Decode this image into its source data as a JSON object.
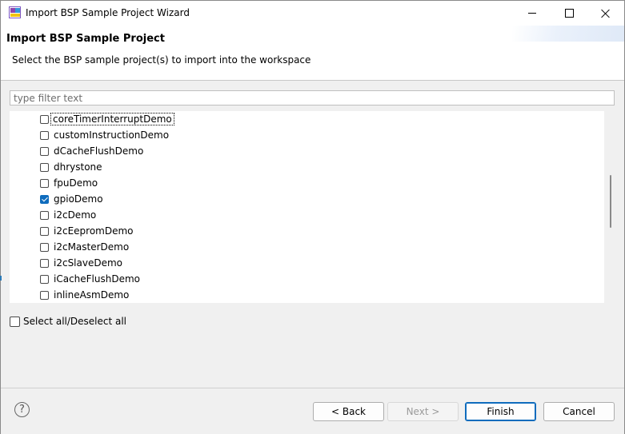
{
  "window": {
    "title": "Import BSP Sample Project Wizard"
  },
  "header": {
    "title": "Import BSP Sample Project",
    "description": "Select the BSP sample project(s) to import into the workspace"
  },
  "filter": {
    "placeholder": "type filter text",
    "value": ""
  },
  "projects": [
    {
      "label": "coreTimerInterruptDemo",
      "checked": false
    },
    {
      "label": "customInstructionDemo",
      "checked": false
    },
    {
      "label": "dCacheFlushDemo",
      "checked": false
    },
    {
      "label": "dhrystone",
      "checked": false
    },
    {
      "label": "fpuDemo",
      "checked": false
    },
    {
      "label": "gpioDemo",
      "checked": true
    },
    {
      "label": "i2cDemo",
      "checked": false
    },
    {
      "label": "i2cEepromDemo",
      "checked": false
    },
    {
      "label": "i2cMasterDemo",
      "checked": false
    },
    {
      "label": "i2cSlaveDemo",
      "checked": false
    },
    {
      "label": "iCacheFlushDemo",
      "checked": false
    },
    {
      "label": "inlineAsmDemo",
      "checked": false
    }
  ],
  "select_all": {
    "label": "Select all/Deselect all",
    "checked": false
  },
  "buttons": {
    "help": "?",
    "back": "< Back",
    "next": "Next >",
    "finish": "Finish",
    "cancel": "Cancel"
  },
  "colors": {
    "accent": "#0f6cbd"
  }
}
